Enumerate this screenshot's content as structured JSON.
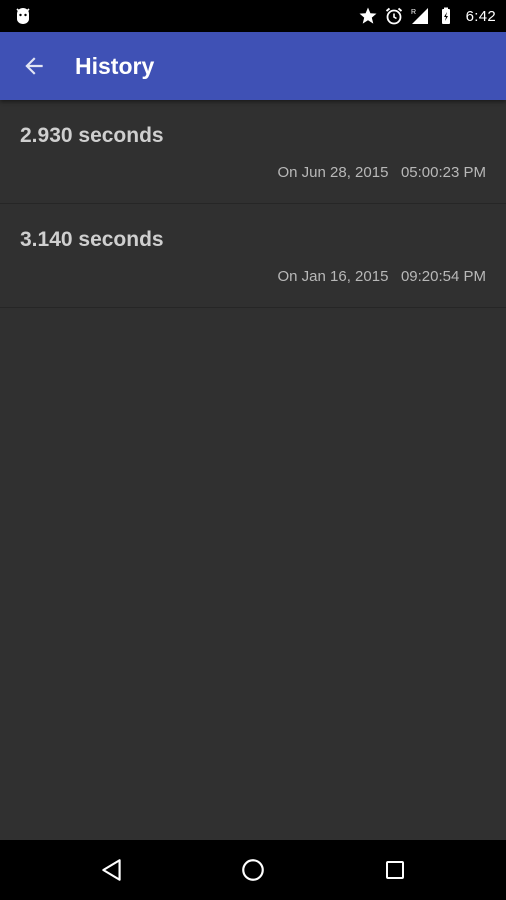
{
  "status_bar": {
    "time": "6:42",
    "icons": [
      "android-debug-icon",
      "star-icon",
      "alarm-icon",
      "signal-icon",
      "battery-charging-icon"
    ]
  },
  "app_bar": {
    "title": "History",
    "color": "#3f51b5"
  },
  "history": {
    "items": [
      {
        "duration": "2.930 seconds",
        "date": "On Jun 28, 2015",
        "time": "05:00:23 PM"
      },
      {
        "duration": "3.140 seconds",
        "date": "On Jan 16, 2015",
        "time": "09:20:54 PM"
      }
    ]
  },
  "nav_bar": {
    "icons": [
      "back-triangle-icon",
      "home-circle-icon",
      "recents-square-icon"
    ]
  }
}
